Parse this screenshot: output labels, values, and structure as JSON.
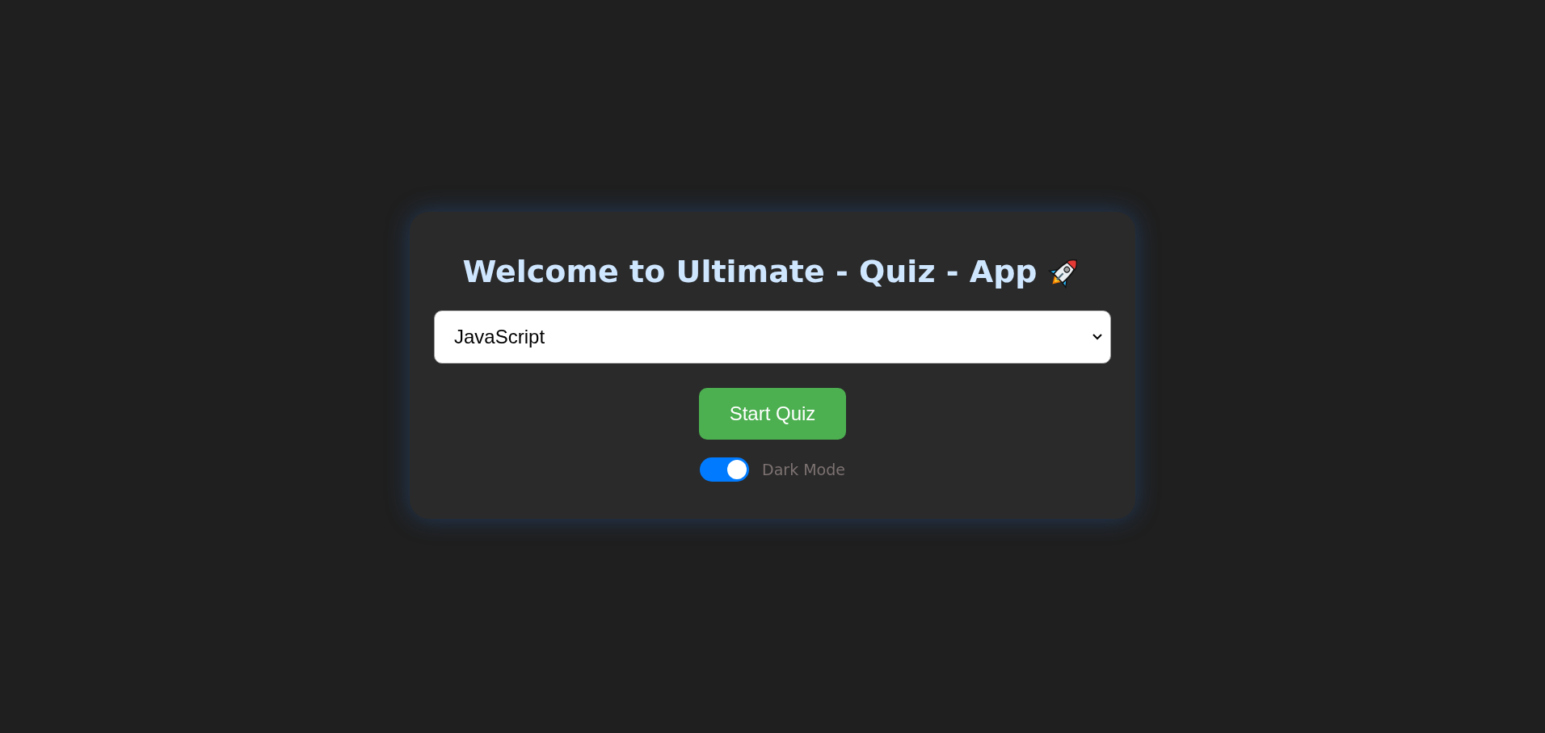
{
  "card": {
    "title": "Welcome to Ultimate - Quiz - App",
    "topic_select": {
      "value": "JavaScript"
    },
    "start_button": "Start Quiz",
    "dark_mode": {
      "label": "Dark Mode",
      "on": true
    }
  }
}
